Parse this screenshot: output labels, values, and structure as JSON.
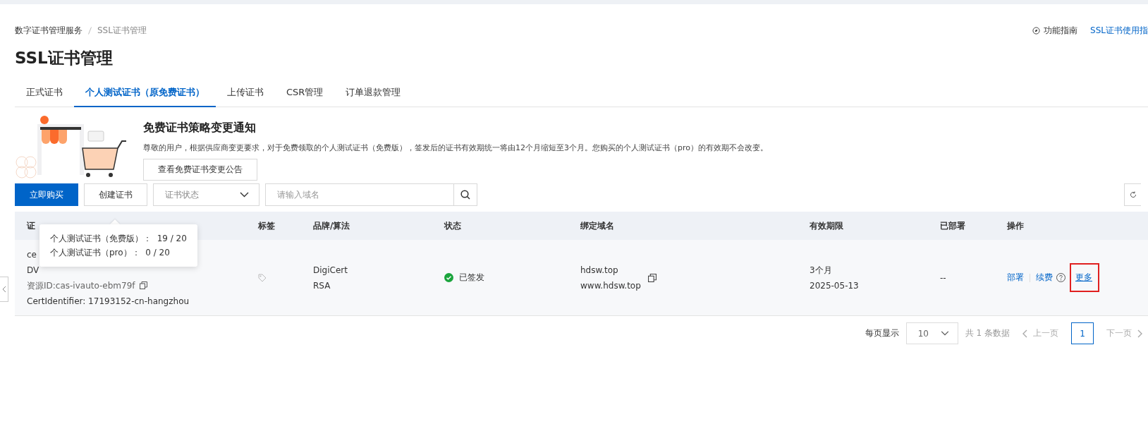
{
  "breadcrumb": [
    "数字证书管理服务",
    "SSL证书管理"
  ],
  "header_links": [
    {
      "kind": "guide",
      "label": "功能指南"
    },
    {
      "kind": "link",
      "label": "SSL证书使用指"
    }
  ],
  "title": "SSL证书管理",
  "tabs": [
    {
      "label": "正式证书",
      "selected": false
    },
    {
      "label": "个人测试证书（原免费证书）",
      "selected": true
    },
    {
      "label": "上传证书",
      "selected": false
    },
    {
      "label": "CSR管理",
      "selected": false
    },
    {
      "label": "订单退款管理",
      "selected": false
    }
  ],
  "notice": {
    "title": "免费证书策略变更通知",
    "text": "尊敬的用户，根据供应商变更要求，对于免费领取的个人测试证书（免费版），签发后的证书有效期统一将由12个月缩短至3个月。您购买的个人测试证书（pro）的有效期不会改变。",
    "button": "查看免费证书变更公告"
  },
  "toolbar": {
    "buy_button": "立即购买",
    "create_button": "创建证书",
    "status_select": {
      "placeholder": "证书状态"
    },
    "search": {
      "placeholder": "请输入域名"
    }
  },
  "table": {
    "columns": [
      "证",
      "标签",
      "品牌/算法",
      "状态",
      "绑定域名",
      "有效期限",
      "已部署",
      "操作"
    ],
    "rows": [
      {
        "cert_name": "ce",
        "cert_type": "DV",
        "resource_id": "资源ID:cas-ivauto-ebm79f",
        "cert_identifier": "CertIdentifier: 17193152-cn-hangzhou",
        "brand": "DigiCert",
        "algorithm": "RSA",
        "status": "已签发",
        "domains": [
          "hdsw.top",
          "www.hdsw.top"
        ],
        "validity": "3个月",
        "expiry": "2025-05-13",
        "deployed": "--",
        "actions": [
          {
            "label": "部署",
            "kind": "link"
          },
          {
            "label": "续费",
            "kind": "help"
          },
          {
            "label": "更多",
            "kind": "highlighted"
          }
        ]
      }
    ]
  },
  "tooltip": [
    "个人测试证书（免费版）：  19 / 20",
    "个人测试证书（pro）：  0 / 20"
  ],
  "pagination": {
    "page_size_label": "每页显示",
    "page_size": "10",
    "total": "共 1 条数据",
    "prev": "上一页",
    "pages": [
      {
        "label": "1",
        "selected": true
      }
    ],
    "next": "下一页"
  }
}
